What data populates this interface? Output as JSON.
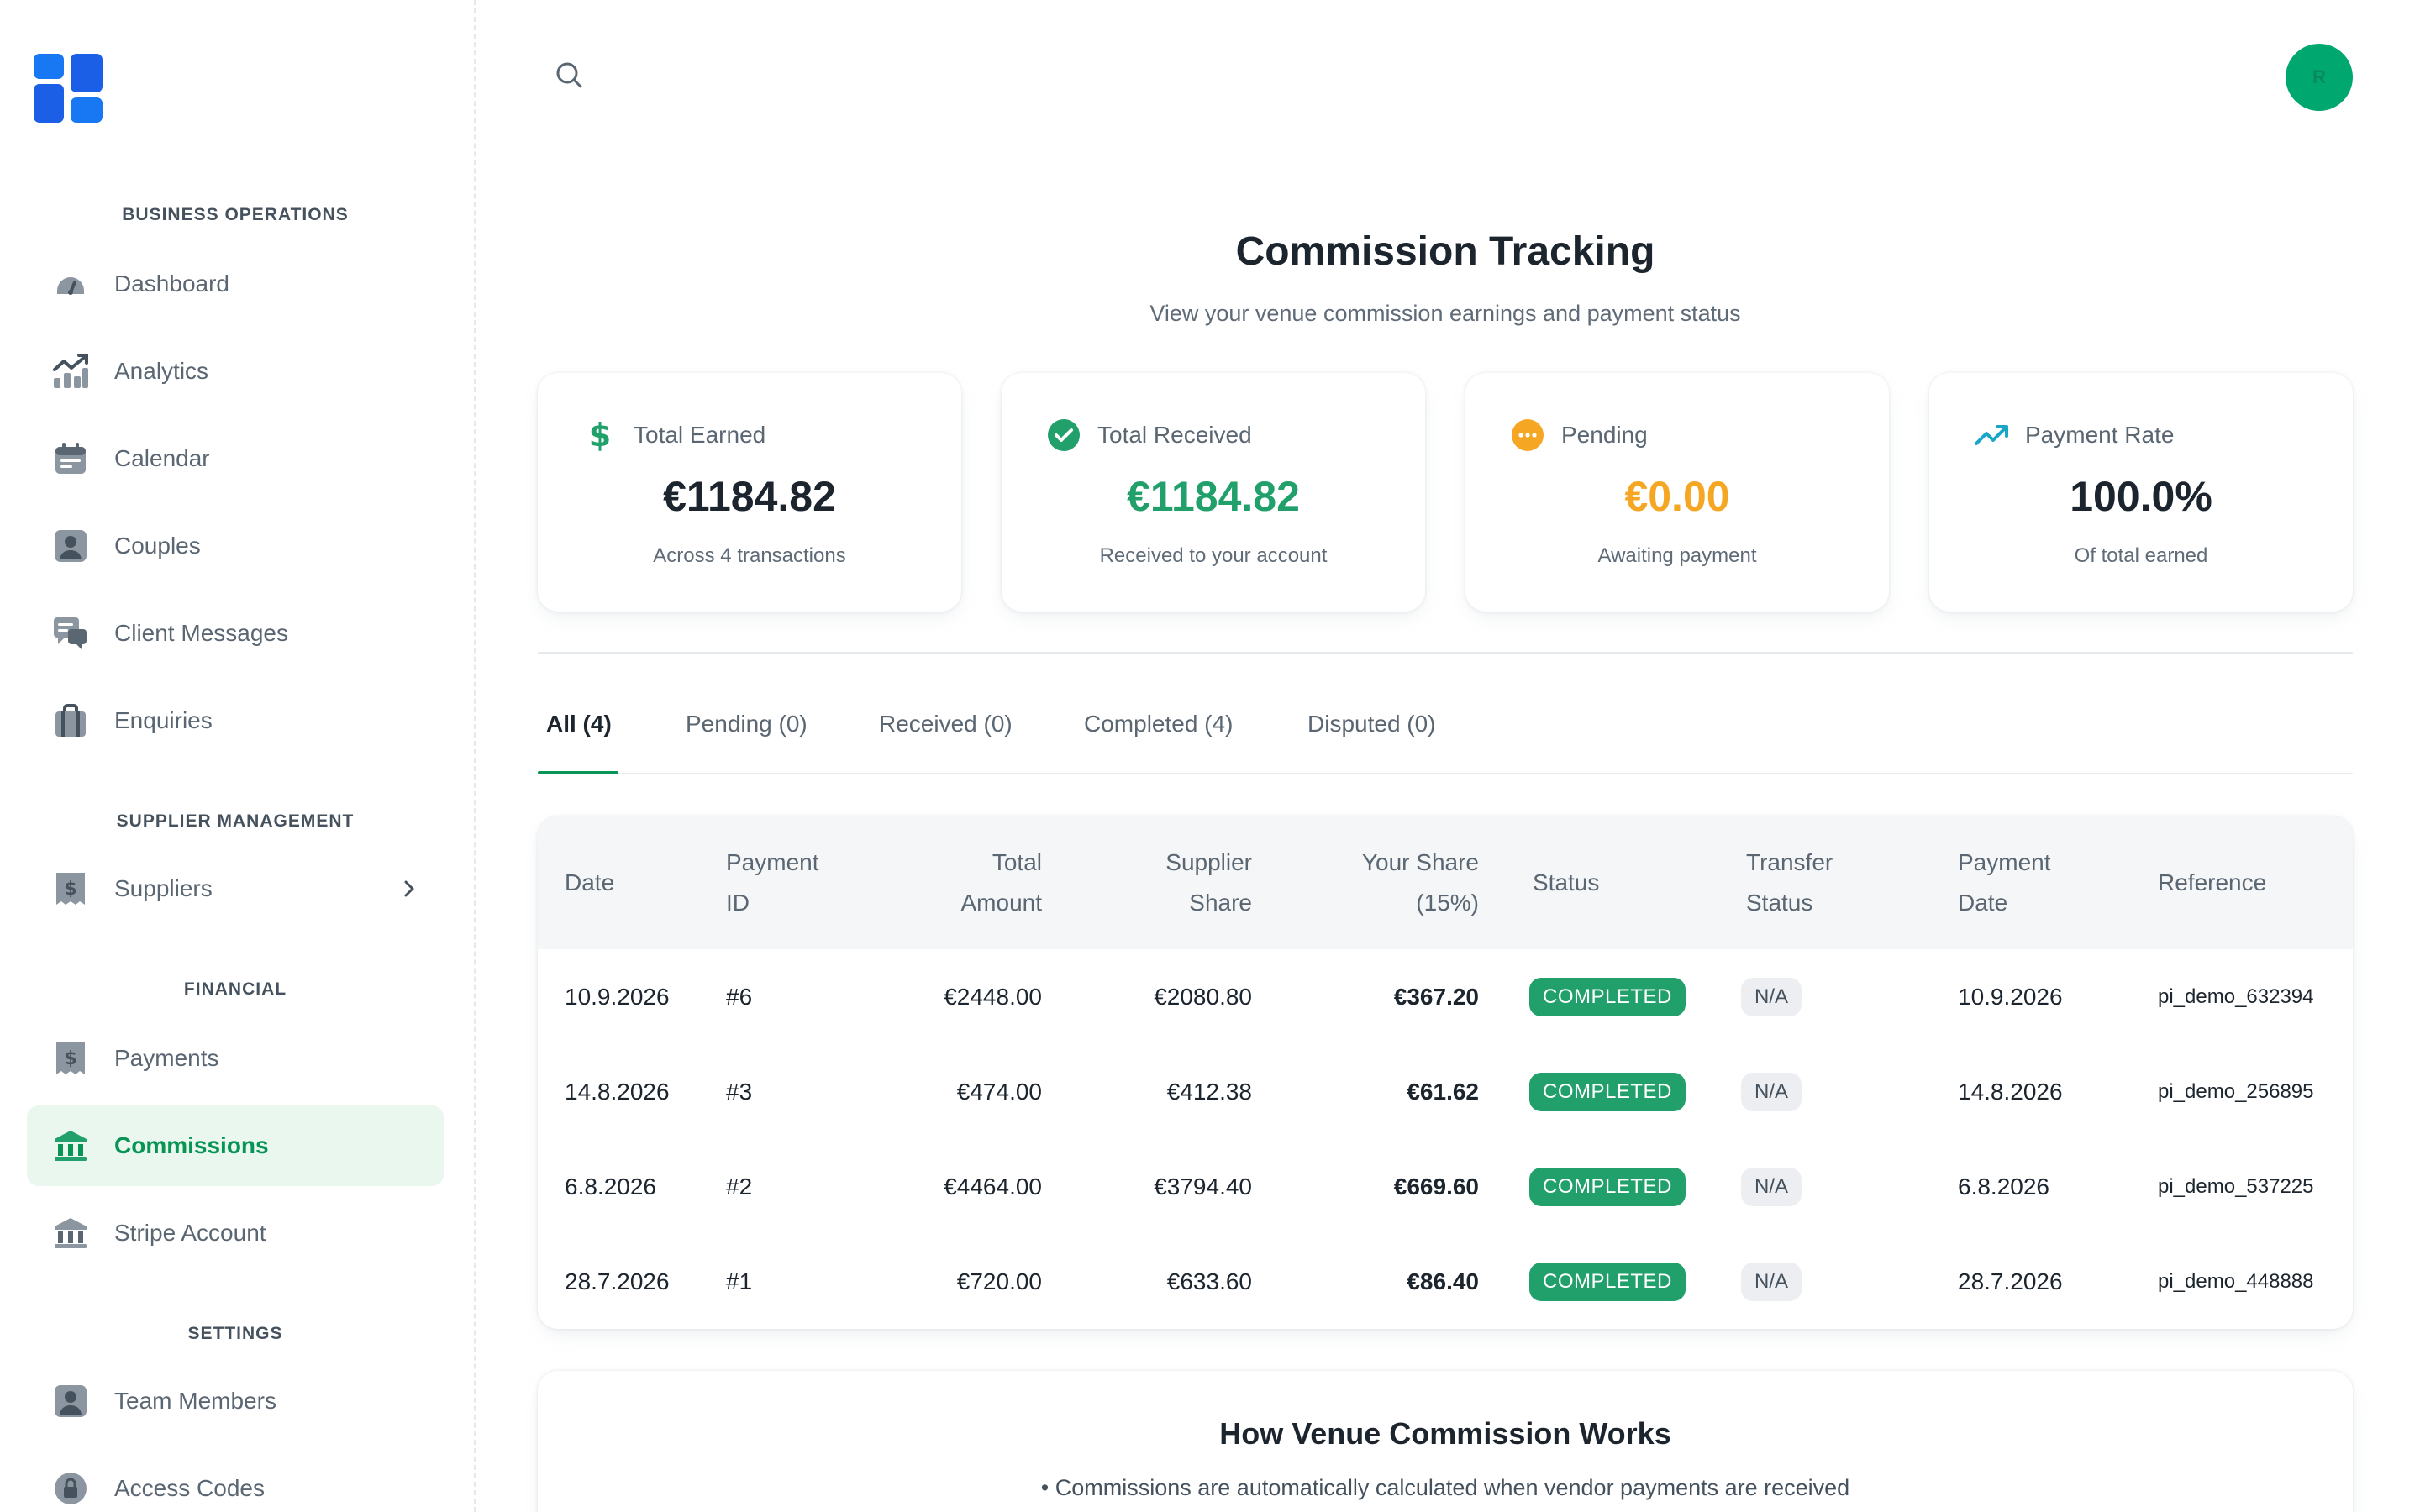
{
  "sidebar": {
    "sections": {
      "business": "BUSINESS OPERATIONS",
      "supplier": "SUPPLIER MANAGEMENT",
      "financial": "FINANCIAL",
      "settings": "SETTINGS"
    },
    "items": {
      "dashboard": "Dashboard",
      "analytics": "Analytics",
      "calendar": "Calendar",
      "couples": "Couples",
      "client_messages": "Client Messages",
      "enquiries": "Enquiries",
      "suppliers": "Suppliers",
      "payments": "Payments",
      "commissions": "Commissions",
      "stripe_account": "Stripe Account",
      "team_members": "Team Members",
      "access_codes": "Access Codes"
    },
    "active_item": "commissions",
    "accent_color": "#079455"
  },
  "topbar": {
    "search_icon": "search-icon",
    "avatar_initial": "R",
    "avatar_color": "#00a76f"
  },
  "header": {
    "title": "Commission Tracking",
    "subtitle": "View your venue commission earnings and payment status"
  },
  "stats": {
    "total_earned": {
      "label": "Total Earned",
      "value": "€1184.82",
      "caption": "Across 4 transactions",
      "icon": "dollar-icon",
      "color": "#1c252e"
    },
    "total_received": {
      "label": "Total Received",
      "value": "€1184.82",
      "caption": "Received to your account",
      "icon": "check-circle-icon",
      "color": "#22a06b"
    },
    "pending": {
      "label": "Pending",
      "value": "€0.00",
      "caption": "Awaiting payment",
      "icon": "more-circle-icon",
      "color": "#f5a623"
    },
    "payment_rate": {
      "label": "Payment Rate",
      "value": "100.0%",
      "caption": "Of total earned",
      "icon": "trending-up-icon",
      "color": "#1c252e"
    }
  },
  "tabs": {
    "all": "All (4)",
    "pending": "Pending (0)",
    "received": "Received (0)",
    "completed": "Completed (4)",
    "disputed": "Disputed (0)"
  },
  "table": {
    "headers": {
      "date": "Date",
      "payment_id_1": "Payment",
      "payment_id_2": "ID",
      "total_1": "Total",
      "total_2": "Amount",
      "supplier_1": "Supplier",
      "supplier_2": "Share",
      "share_1": "Your Share",
      "share_2": "(15%)",
      "status": "Status",
      "transfer_1": "Transfer",
      "transfer_2": "Status",
      "pdate_1": "Payment",
      "pdate_2": "Date",
      "reference": "Reference"
    },
    "rows": [
      {
        "date": "10.9.2026",
        "id": "#6",
        "total": "€2448.00",
        "supplier": "€2080.80",
        "share": "€367.20",
        "status": "COMPLETED",
        "transfer": "N/A",
        "pdate": "10.9.2026",
        "ref": "pi_demo_632394"
      },
      {
        "date": "14.8.2026",
        "id": "#3",
        "total": "€474.00",
        "supplier": "€412.38",
        "share": "€61.62",
        "status": "COMPLETED",
        "transfer": "N/A",
        "pdate": "14.8.2026",
        "ref": "pi_demo_256895"
      },
      {
        "date": "6.8.2026",
        "id": "#2",
        "total": "€4464.00",
        "supplier": "€3794.40",
        "share": "€669.60",
        "status": "COMPLETED",
        "transfer": "N/A",
        "pdate": "6.8.2026",
        "ref": "pi_demo_537225"
      },
      {
        "date": "28.7.2026",
        "id": "#1",
        "total": "€720.00",
        "supplier": "€633.60",
        "share": "€86.40",
        "status": "COMPLETED",
        "transfer": "N/A",
        "pdate": "28.7.2026",
        "ref": "pi_demo_448888"
      }
    ]
  },
  "how": {
    "title": "How Venue Commission Works",
    "line1": "• Commissions are automatically calculated when vendor payments are received"
  }
}
